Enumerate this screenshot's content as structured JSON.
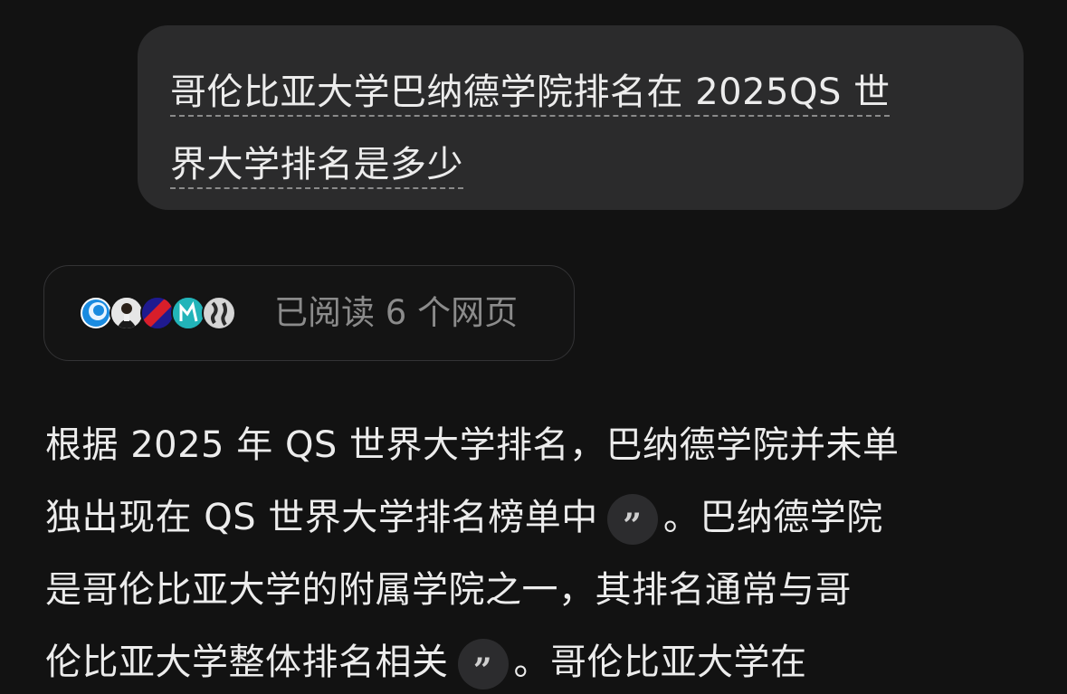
{
  "user_message": {
    "line1": "哥伦比亚大学巴纳德学院排名在 2025QS 世",
    "line2": "界大学排名是多少"
  },
  "sources": {
    "label": "已阅读 6 个网页",
    "favicons": [
      "globe-blue-icon",
      "person-photo-icon",
      "red-stripe-icon",
      "teal-logo-icon",
      "globe-gray-icon"
    ]
  },
  "answer": {
    "line1": "根据 2025 年 QS 世界大学排名，巴纳德学院并未单",
    "line2a": "独出现在 QS 世界大学排名榜单中",
    "cite1": "”",
    "line2b": "。巴纳德学院",
    "line3": "是哥伦比亚大学的附属学院之一，其排名通常与哥",
    "line4a": "伦比亚大学整体排名相关",
    "cite2": "”",
    "line4b": "。哥伦比亚大学在"
  },
  "colors": {
    "background": "#121212",
    "bubble": "#2b2b2c",
    "text": "#ececec",
    "muted": "#8b8b8b"
  }
}
